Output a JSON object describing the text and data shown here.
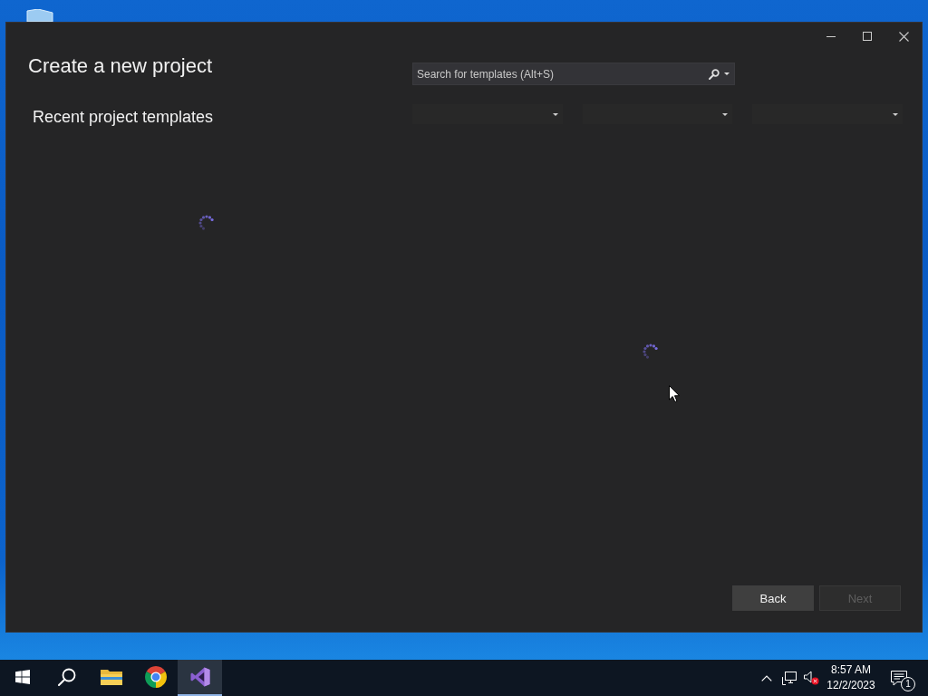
{
  "window": {
    "title": "Create a new project"
  },
  "recent_templates": {
    "heading": "Recent project templates",
    "loading": true
  },
  "search": {
    "placeholder": "Search for templates (Alt+S)"
  },
  "template_list": {
    "loading": true
  },
  "buttons": [
    {
      "label": "Back",
      "disabled": false
    },
    {
      "label": "Next",
      "disabled": true
    }
  ],
  "taskbar": {
    "apps": [
      {
        "kind": "start",
        "selected": false
      },
      {
        "kind": "search",
        "selected": false
      },
      {
        "kind": "folder",
        "selected": false
      },
      {
        "kind": "browser",
        "selected": false
      },
      {
        "kind": "ide",
        "selected": true
      }
    ],
    "tray": {
      "volume_muted": true,
      "time": "8:57 AM",
      "date": "12/2/2023",
      "notification_count": "1"
    }
  }
}
